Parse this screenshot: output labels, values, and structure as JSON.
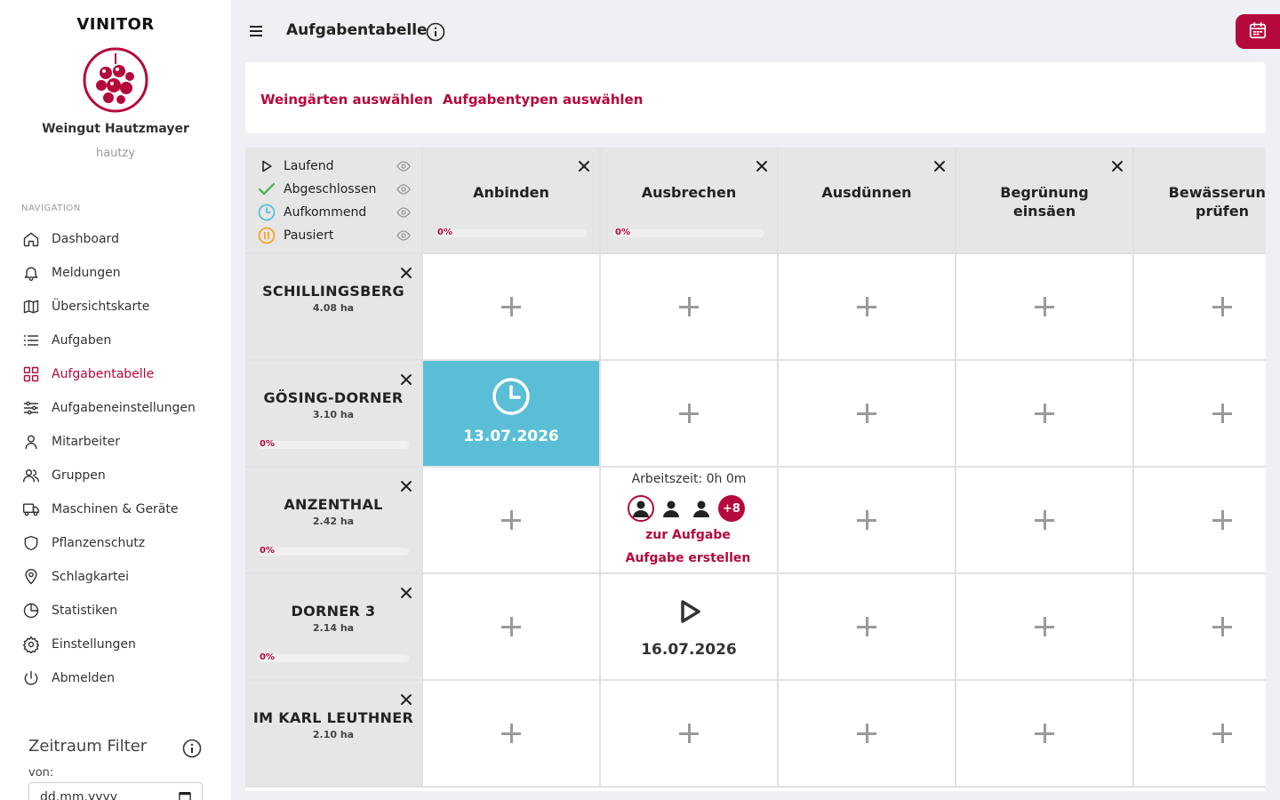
{
  "app": {
    "brand": "VINITOR",
    "org_name": "Weingut Hautzmayer",
    "org_user": "hautzy"
  },
  "nav": {
    "heading": "NAVIGATION",
    "items": [
      {
        "label": "Dashboard",
        "icon": "home-icon"
      },
      {
        "label": "Meldungen",
        "icon": "bell-icon"
      },
      {
        "label": "Übersichtskarte",
        "icon": "map-icon"
      },
      {
        "label": "Aufgaben",
        "icon": "list-icon"
      },
      {
        "label": "Aufgabentabelle",
        "icon": "grid-icon",
        "active": true
      },
      {
        "label": "Aufgabeneinstellungen",
        "icon": "sliders-icon"
      },
      {
        "label": "Mitarbeiter",
        "icon": "user-icon"
      },
      {
        "label": "Gruppen",
        "icon": "users-icon"
      },
      {
        "label": "Maschinen & Geräte",
        "icon": "truck-icon"
      },
      {
        "label": "Pflanzenschutz",
        "icon": "shield-icon"
      },
      {
        "label": "Schlagkartei",
        "icon": "map-pin-icon"
      },
      {
        "label": "Statistiken",
        "icon": "pie-chart-icon"
      },
      {
        "label": "Einstellungen",
        "icon": "gear-icon"
      },
      {
        "label": "Abmelden",
        "icon": "power-icon"
      }
    ]
  },
  "filter": {
    "title": "Zeitraum Filter",
    "from_label": "von:",
    "from_placeholder": "dd.mm.yyyy"
  },
  "header": {
    "title": "Aufgabentabelle"
  },
  "selectors": {
    "vineyards": "Weingärten auswählen",
    "task_types": "Aufgabentypen auswählen"
  },
  "legend": [
    {
      "label": "Laufend",
      "icon": "play-icon"
    },
    {
      "label": "Abgeschlossen",
      "icon": "check-icon"
    },
    {
      "label": "Aufkommend",
      "icon": "clock-icon"
    },
    {
      "label": "Pausiert",
      "icon": "pause-icon"
    }
  ],
  "columns": [
    {
      "name": "Anbinden",
      "progress": "0%",
      "closable": true
    },
    {
      "name": "Ausbrechen",
      "progress": "0%",
      "closable": true
    },
    {
      "name": "Ausdünnen",
      "closable": true
    },
    {
      "name": "Begrünung einsäen",
      "closable": true
    },
    {
      "name": "Bewässerung prüfen"
    }
  ],
  "rows": [
    {
      "name": "SCHILLINGSBERG",
      "area": "4.08 ha"
    },
    {
      "name": "GÖSING-DORNER",
      "area": "3.10 ha",
      "progress": "0%"
    },
    {
      "name": "ANZENTHAL",
      "area": "2.42 ha",
      "progress": "0%"
    },
    {
      "name": "DORNER 3",
      "area": "2.14 ha",
      "progress": "0%"
    },
    {
      "name": "IM KARL LEUTHNER",
      "area": "2.10 ha"
    }
  ],
  "tasks": {
    "upcoming": {
      "date": "13.07.2026",
      "status": "Aufkommend",
      "color": "#5abfd6"
    },
    "detail": {
      "work_time": "Arbeitszeit: 0h 0m",
      "more_count": "+8",
      "link_open": "zur Aufgabe",
      "link_create": "Aufgabe erstellen"
    },
    "running": {
      "date": "16.07.2026",
      "status": "Laufend"
    }
  },
  "colors": {
    "accent": "#b5093b",
    "upcoming": "#5abfd6",
    "completed": "#3cb54a",
    "paused": "#f5a623"
  }
}
